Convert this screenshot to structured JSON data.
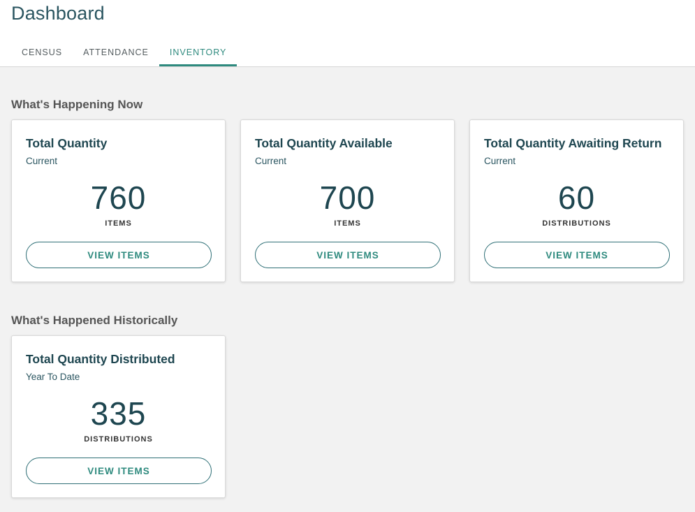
{
  "page": {
    "title": "Dashboard"
  },
  "tabs": [
    {
      "label": "CENSUS",
      "active": false
    },
    {
      "label": "ATTENDANCE",
      "active": false
    },
    {
      "label": "INVENTORY",
      "active": true
    }
  ],
  "colors": {
    "accent": "#2e8a7e",
    "title_text": "#1e4650",
    "background": "#f2f2f2"
  },
  "sections": [
    {
      "heading": "What's Happening Now",
      "cards": [
        {
          "title": "Total Quantity",
          "subtitle": "Current",
          "value": "760",
          "unit": "ITEMS",
          "button": "VIEW ITEMS"
        },
        {
          "title": "Total Quantity Available",
          "subtitle": "Current",
          "value": "700",
          "unit": "ITEMS",
          "button": "VIEW ITEMS"
        },
        {
          "title": "Total Quantity Awaiting Return",
          "subtitle": "Current",
          "value": "60",
          "unit": "DISTRIBUTIONS",
          "button": "VIEW ITEMS"
        }
      ]
    },
    {
      "heading": "What's Happened Historically",
      "cards": [
        {
          "title": "Total Quantity Distributed",
          "subtitle": "Year To Date",
          "value": "335",
          "unit": "DISTRIBUTIONS",
          "button": "VIEW ITEMS"
        }
      ]
    }
  ]
}
